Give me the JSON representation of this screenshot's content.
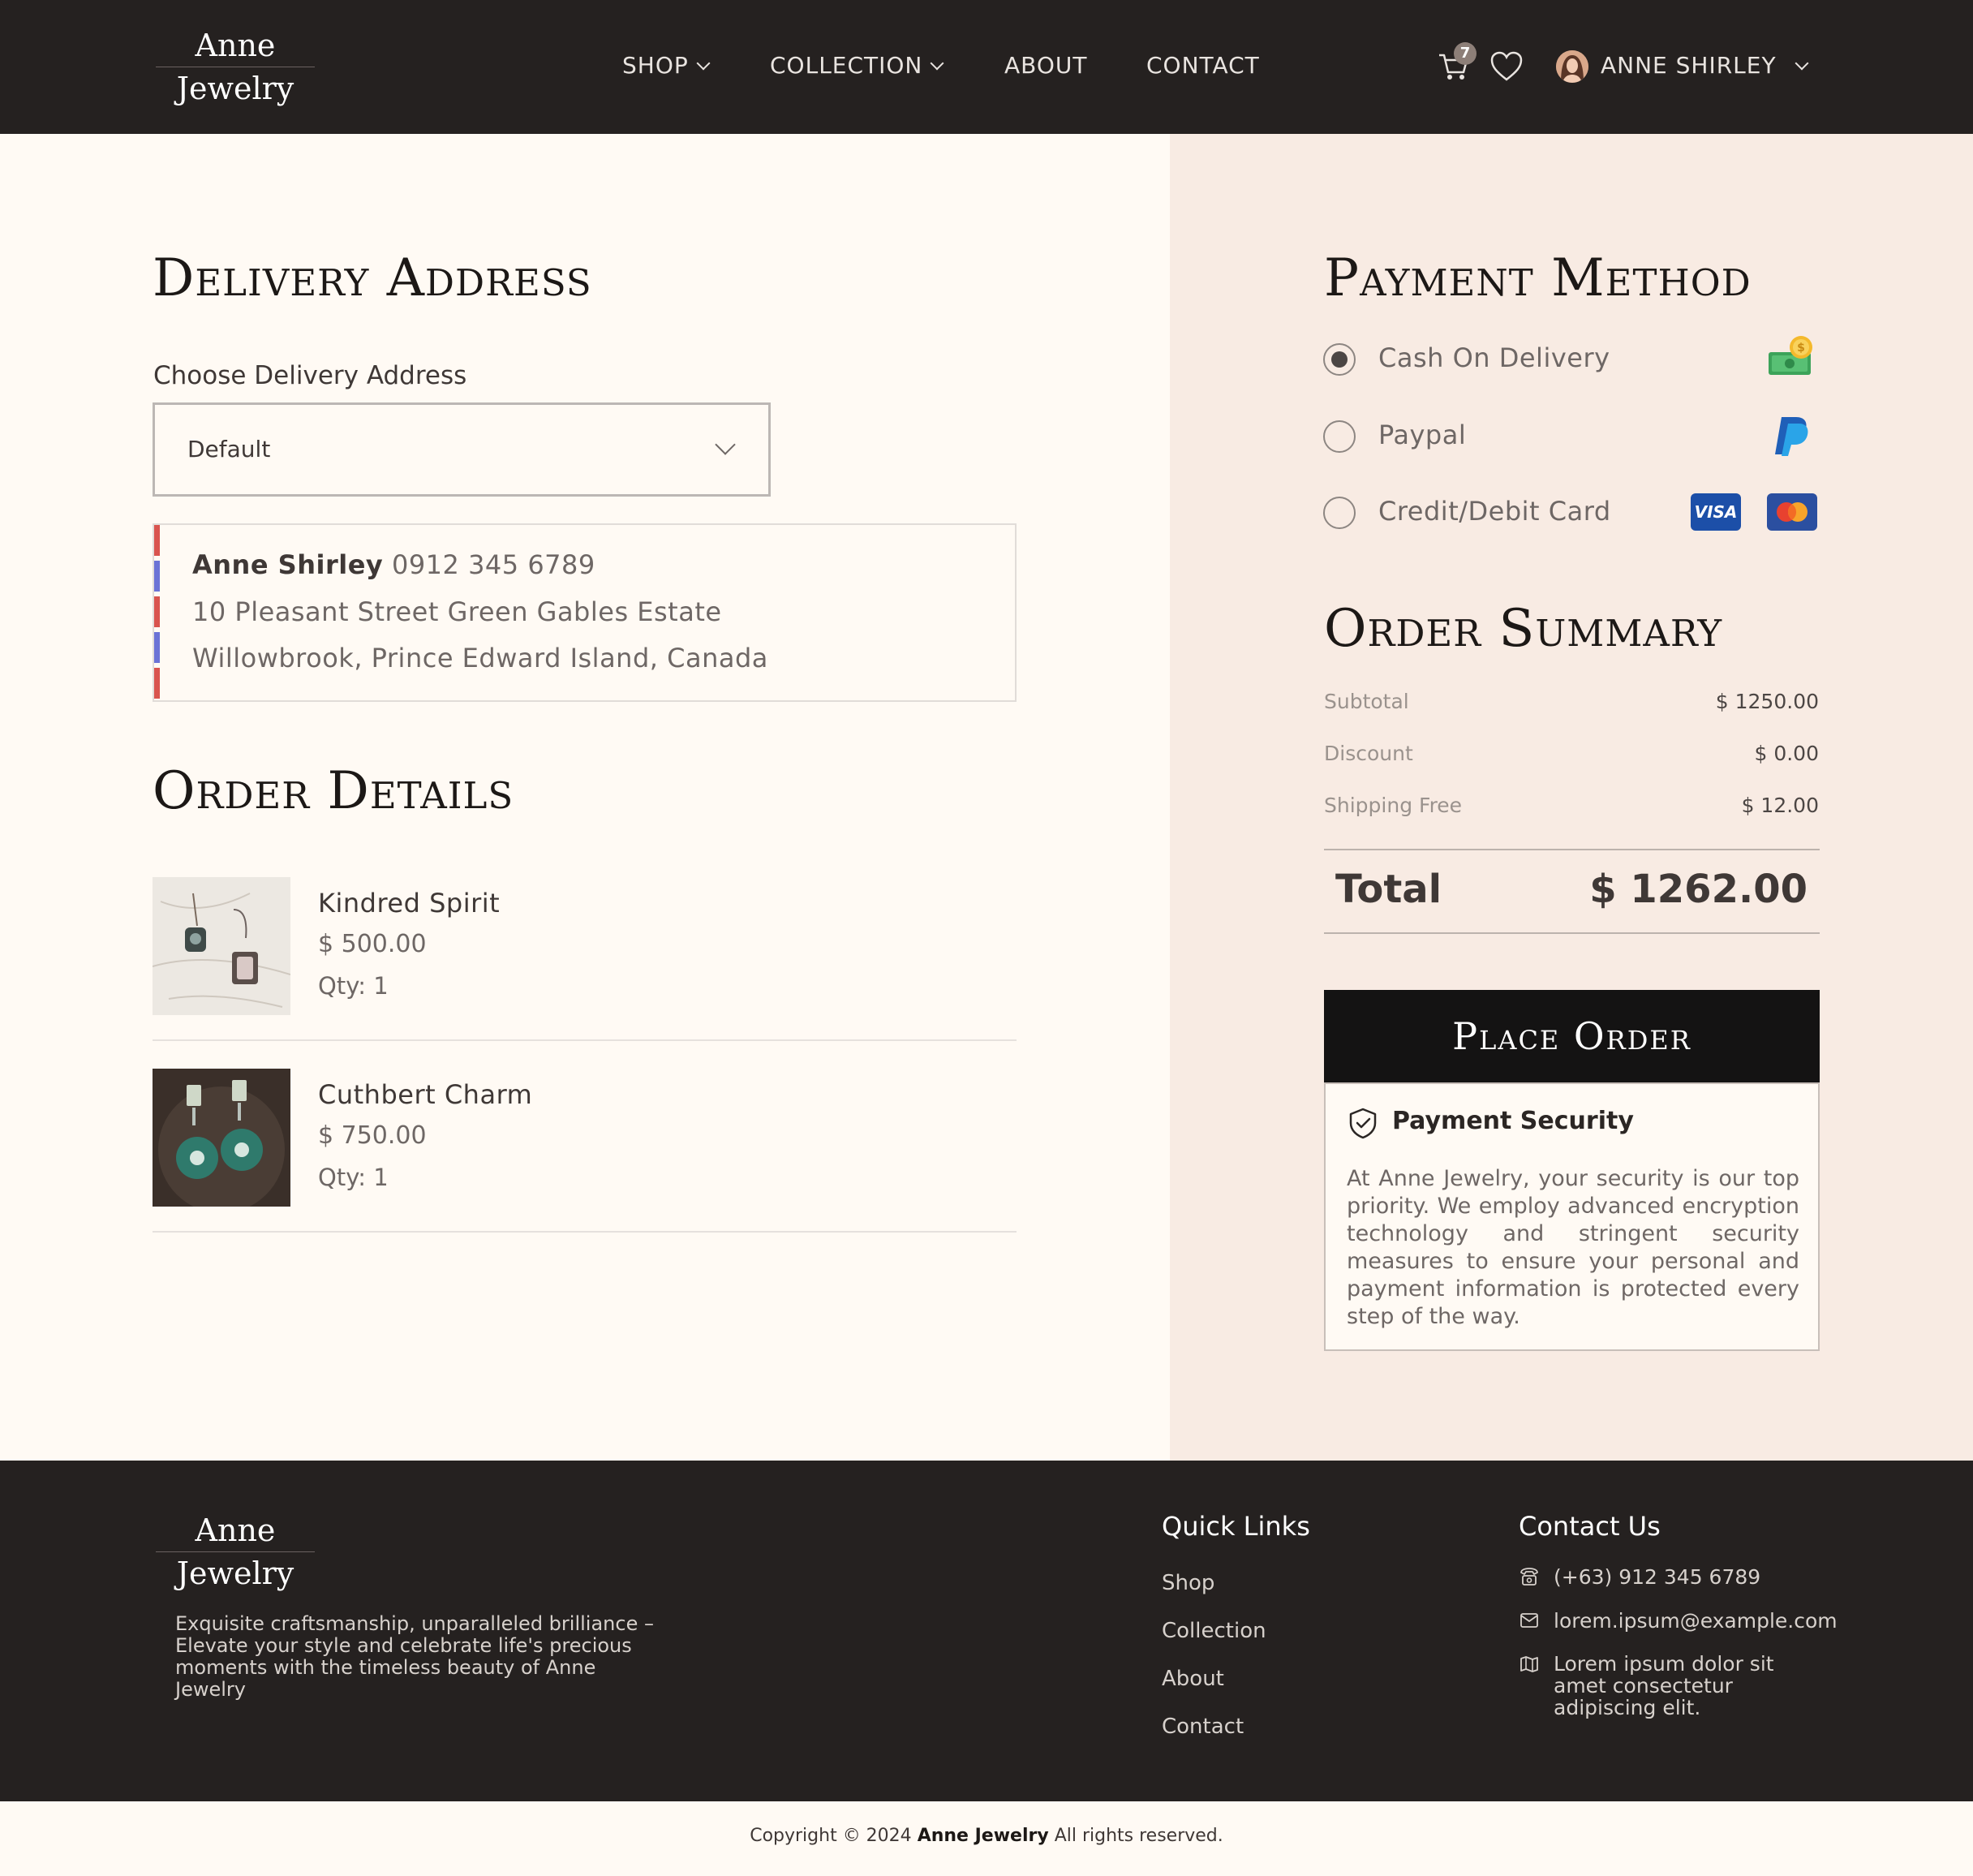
{
  "brand": {
    "line1": "Anne",
    "line2": "Jewelry"
  },
  "nav": {
    "shop": "SHOP",
    "collection": "COLLECTION",
    "about": "ABOUT",
    "contact": "CONTACT"
  },
  "header": {
    "cart_count": "7",
    "user_name": "ANNE SHIRLEY"
  },
  "delivery": {
    "title": "Delivery Address",
    "choose_label": "Choose Delivery Address",
    "selected": "Default",
    "address": {
      "name": "Anne Shirley",
      "phone": "0912 345 6789",
      "line1": "10 Pleasant Street Green Gables Estate",
      "line2": "Willowbrook, Prince Edward Island, Canada"
    }
  },
  "order_details": {
    "title": "Order Details",
    "items": [
      {
        "name": "Kindred Spirit",
        "price": "$ 500.00",
        "qty": "Qty: 1"
      },
      {
        "name": "Cuthbert Charm",
        "price": "$ 750.00",
        "qty": "Qty: 1"
      }
    ]
  },
  "payment": {
    "title": "Payment Method",
    "options": [
      {
        "label": "Cash On Delivery",
        "selected": true
      },
      {
        "label": "Paypal",
        "selected": false
      },
      {
        "label": "Credit/Debit Card",
        "selected": false
      }
    ],
    "visa_text": "VISA"
  },
  "summary": {
    "title": "Order Summary",
    "subtotal_label": "Subtotal",
    "subtotal": "$ 1250.00",
    "discount_label": "Discount",
    "discount": "$ 0.00",
    "shipping_label": "Shipping Free",
    "shipping": "$ 12.00",
    "total_label": "Total",
    "total": "$ 1262.00"
  },
  "place_order": "Place Order",
  "security": {
    "title": "Payment Security",
    "text": "At Anne Jewelry, your security is our top priority. We employ advanced encryption technology and stringent security measures to ensure your personal and payment information is protected every step of the way."
  },
  "footer": {
    "description": "Exquisite craftsmanship, unparalleled brilliance – Elevate your style and celebrate life's precious moments with the timeless beauty of Anne Jewelry",
    "quick_links_title": "Quick Links",
    "links": [
      "Shop",
      "Collection",
      "About",
      "Contact"
    ],
    "contact_title": "Contact Us",
    "phone": "(+63) 912 345 6789",
    "email": "lorem.ipsum@example.com",
    "address": "Lorem ipsum dolor sit amet consectetur adipiscing elit."
  },
  "copyright": {
    "prefix": "Copyright © 2024",
    "brand": "Anne Jewelry",
    "suffix": "All rights reserved."
  },
  "colors": {
    "header_bg": "#252120",
    "right_panel_bg": "#f8ebe3",
    "page_bg": "#fffaf4",
    "button_bg": "#141313",
    "stripe_red": "#d9544e",
    "stripe_blue": "#6b73d6"
  }
}
